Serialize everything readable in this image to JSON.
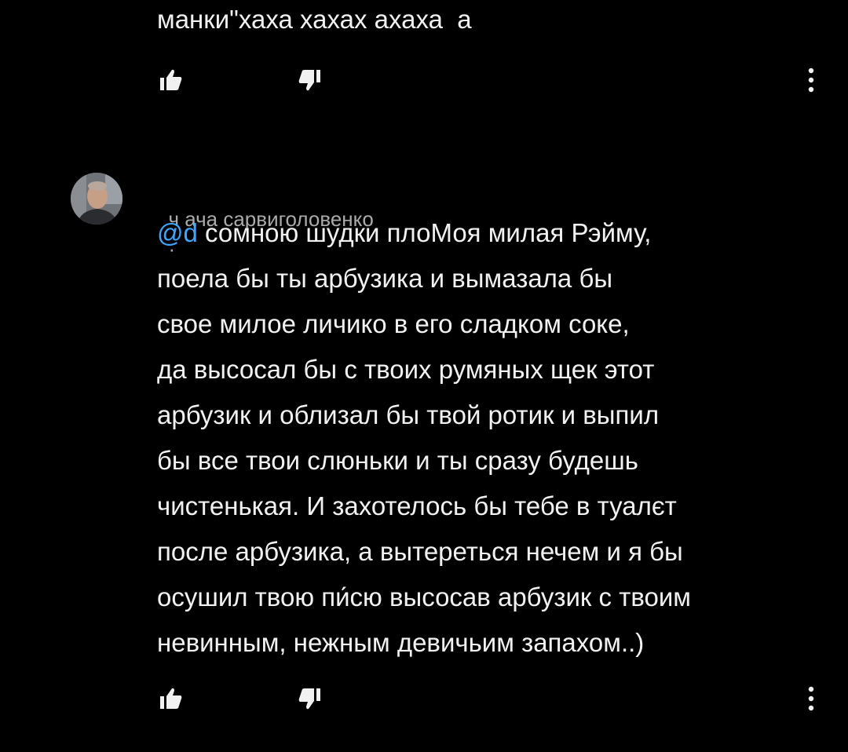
{
  "colors": {
    "background": "#000000",
    "text_primary": "#f1f1f1",
    "text_secondary": "#aaaaaa",
    "mention": "#3ea6ff"
  },
  "previous_comment": {
    "text_tail": "манки\"хаха хахах ахаха  а",
    "actions": {
      "like_icon": "thumbs-up-icon",
      "dislike_icon": "thumbs-down-icon",
      "menu_icon": "more-vertical-icon"
    }
  },
  "comment": {
    "avatar_icon": "user-avatar",
    "author": "ч ача сарвиголовенко",
    "author_suffix": "·",
    "mention": "@d",
    "lines": [
      " сомною шудки плоМоя милая Рэйму,",
      "поела бы ты арбузика и вымазала бы",
      "свое милое личико в его сладком соке,",
      "да высосал бы с твоих румяных щек этот",
      "арбузик и облизал бы твой ротик и выпил",
      "бы все твои слюньки и ты сразу будешь",
      "чистенькая. И захотелось бы тебе в туалєт",
      "после арбузика, а вытереться нечем и я бы",
      "осушил твою пи́сю высосав арбузик с твоим",
      "невинным, нежным девичьим запахом..)"
    ],
    "actions": {
      "like_icon": "thumbs-up-icon",
      "dislike_icon": "thumbs-down-icon",
      "menu_icon": "more-vertical-icon"
    }
  }
}
